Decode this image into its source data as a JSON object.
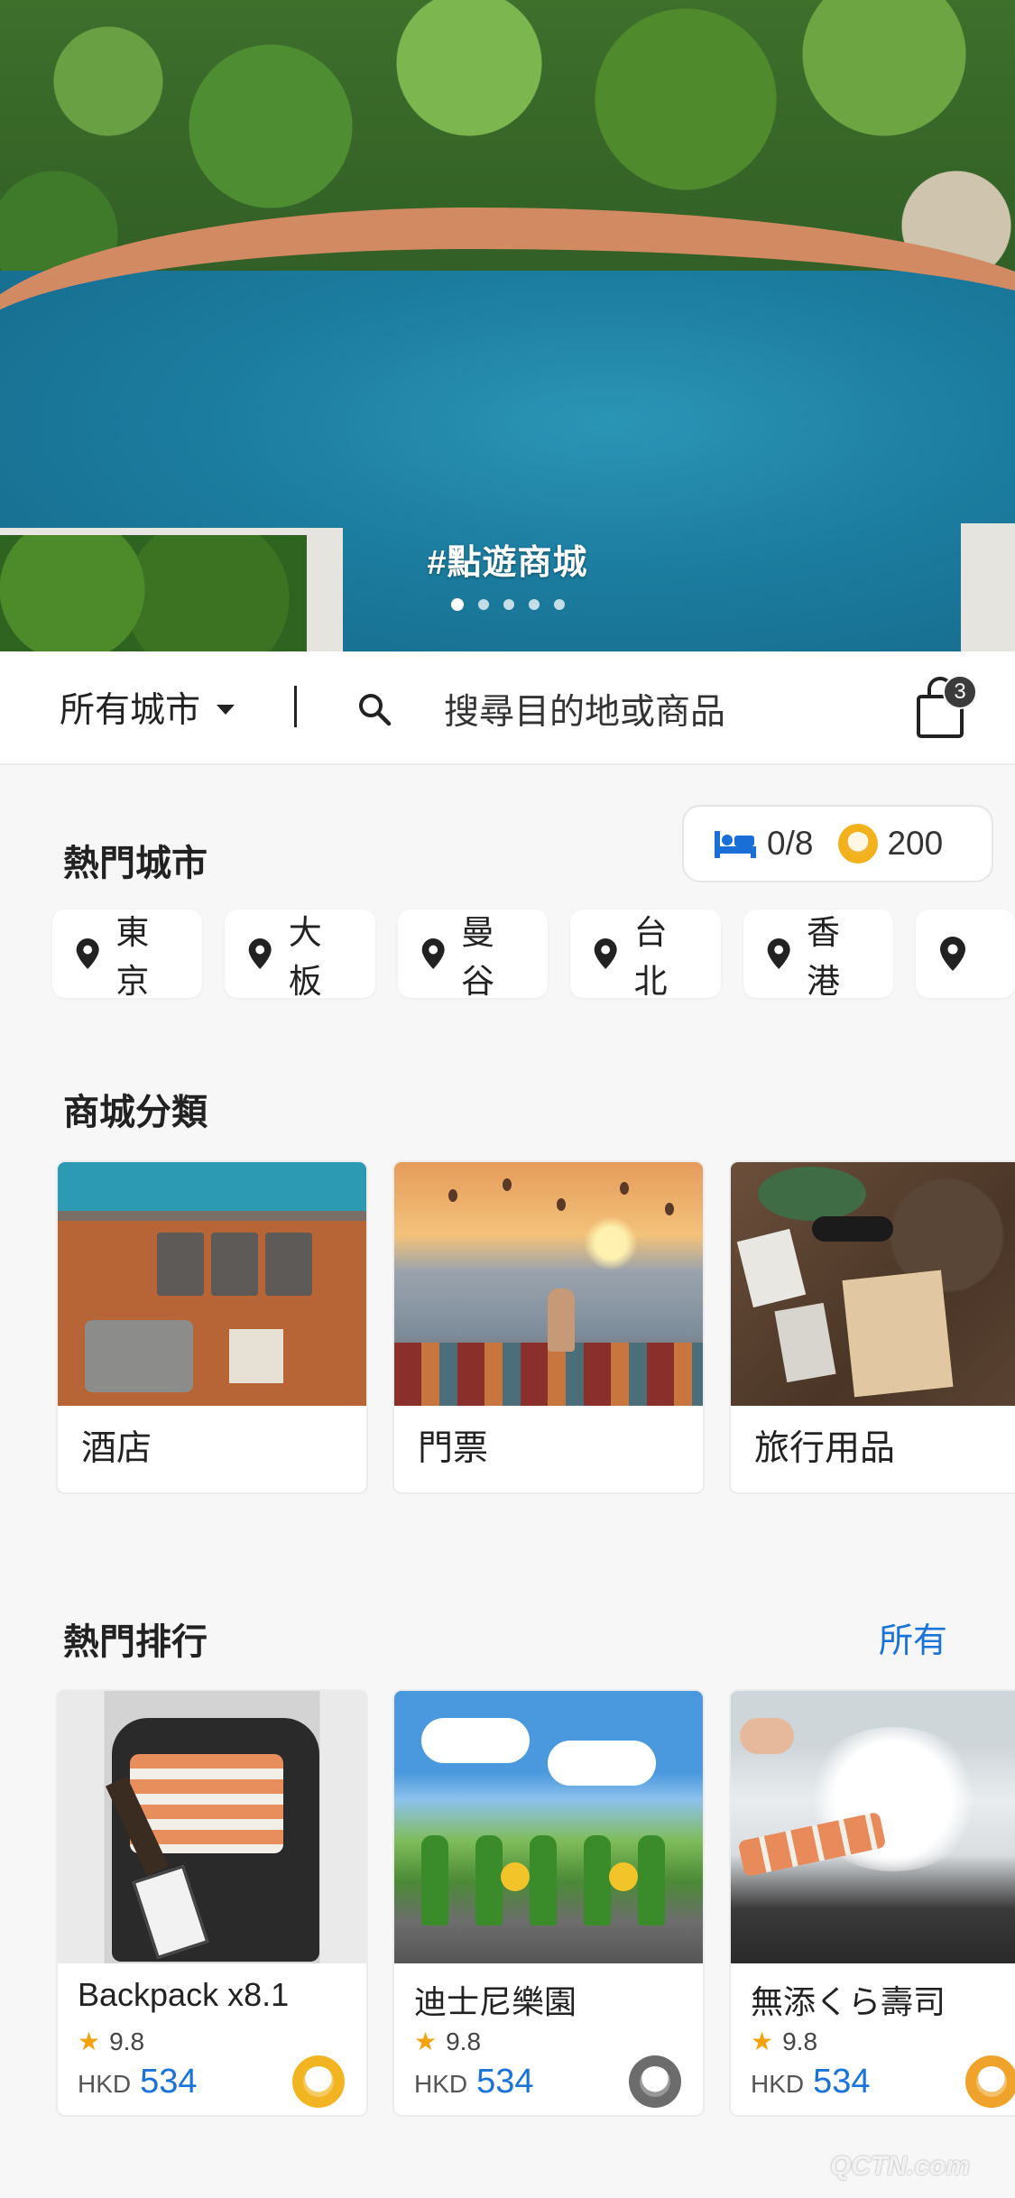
{
  "hero": {
    "caption": "#點遊商城",
    "slides": 5,
    "active_slide": 0
  },
  "searchbar": {
    "city_label": "所有城市",
    "placeholder": "搜尋目的地或商品",
    "cart_count": "3"
  },
  "hot_cities": {
    "title": "熱門城市",
    "stats": {
      "beds": "0/8",
      "coins": "200"
    },
    "cities": [
      "東京",
      "大板",
      "曼谷",
      "台北",
      "香港",
      ""
    ]
  },
  "categories": {
    "title": "商城分類",
    "items": [
      "酒店",
      "門票",
      "旅行用品"
    ]
  },
  "ranking": {
    "title": "熱門排行",
    "all_label": "所有",
    "items": [
      {
        "name": "Backpack x8.1",
        "rating": "9.8",
        "currency": "HKD",
        "price": "534",
        "coin": "gold"
      },
      {
        "name": "迪士尼樂園",
        "rating": "9.8",
        "currency": "HKD",
        "price": "534",
        "coin": "grey"
      },
      {
        "name": "無添くら壽司",
        "rating": "9.8",
        "currency": "HKD",
        "price": "534",
        "coin": "amber"
      }
    ]
  },
  "colors": {
    "accent": "#1a73d9",
    "coin": "#f3b21b",
    "bed_icon": "#1a6fd6"
  },
  "watermark": "QCTN.com"
}
